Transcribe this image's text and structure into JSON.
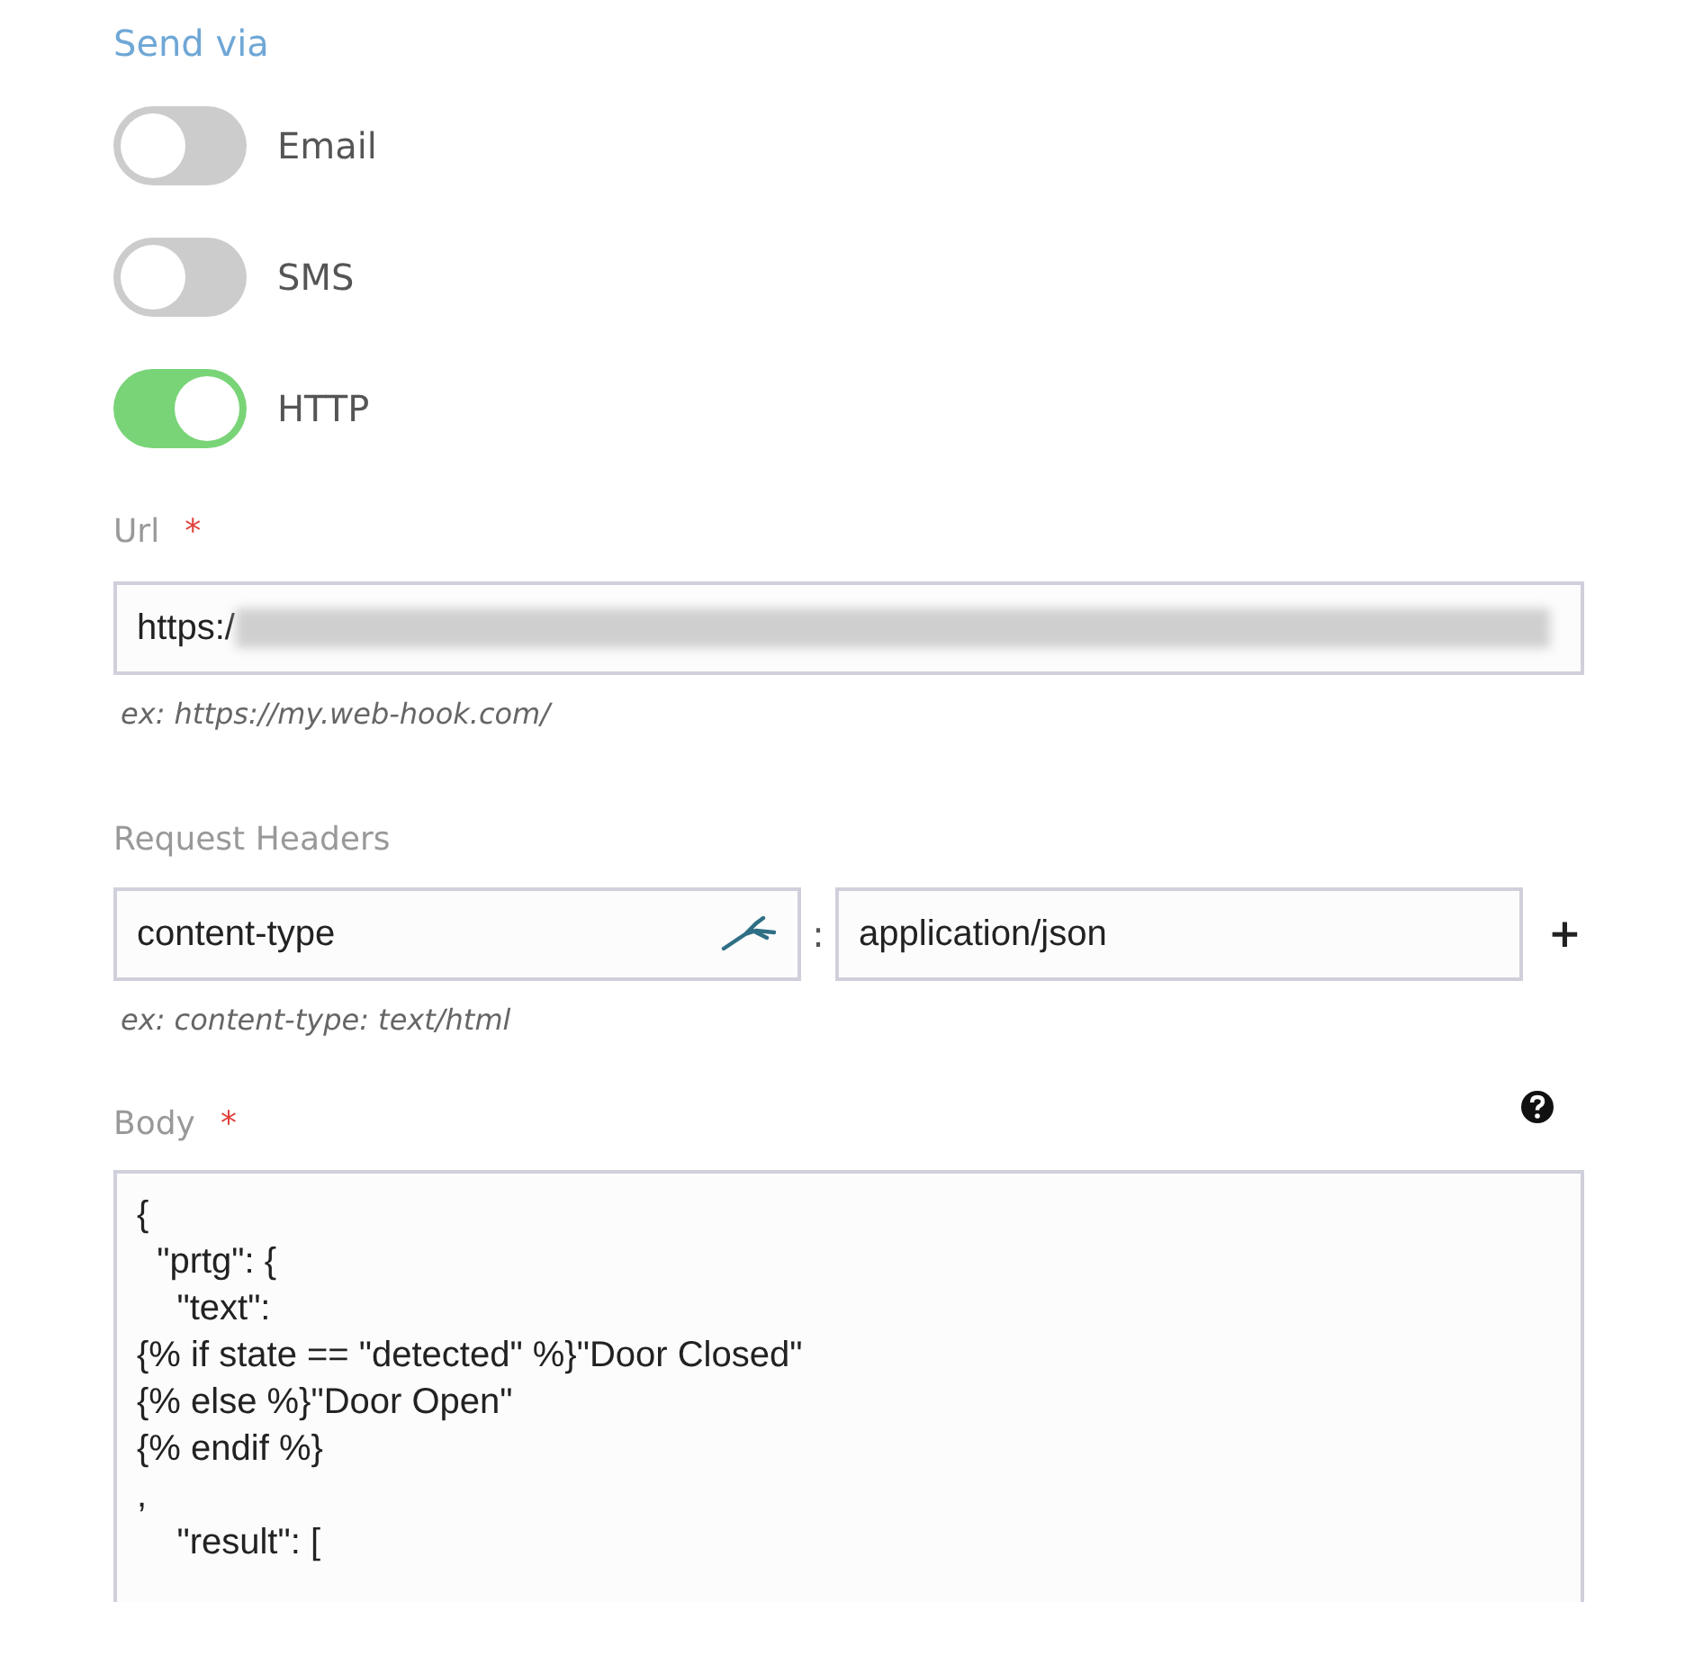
{
  "section_title": "Send via",
  "channels": [
    {
      "label": "Email",
      "on": false
    },
    {
      "label": "SMS",
      "on": false
    },
    {
      "label": "HTTP",
      "on": true
    }
  ],
  "url": {
    "label": "Url",
    "required_mark": "*",
    "value": "https:/",
    "hint": "ex: https://my.web-hook.com/"
  },
  "headers": {
    "label": "Request Headers",
    "name": "content-type",
    "separator": ":",
    "value": "application/json",
    "add_button": "+",
    "hint": "ex: content-type: text/html"
  },
  "body": {
    "label": "Body",
    "required_mark": "*",
    "lines": [
      "{",
      "  \"prtg\": {",
      "    \"text\":",
      "{% if state == \"detected\" %}\"Door Closed\"",
      "{% else %}\"Door Open\"",
      "{% endif %}",
      ",",
      "    \"result\": ["
    ]
  }
}
